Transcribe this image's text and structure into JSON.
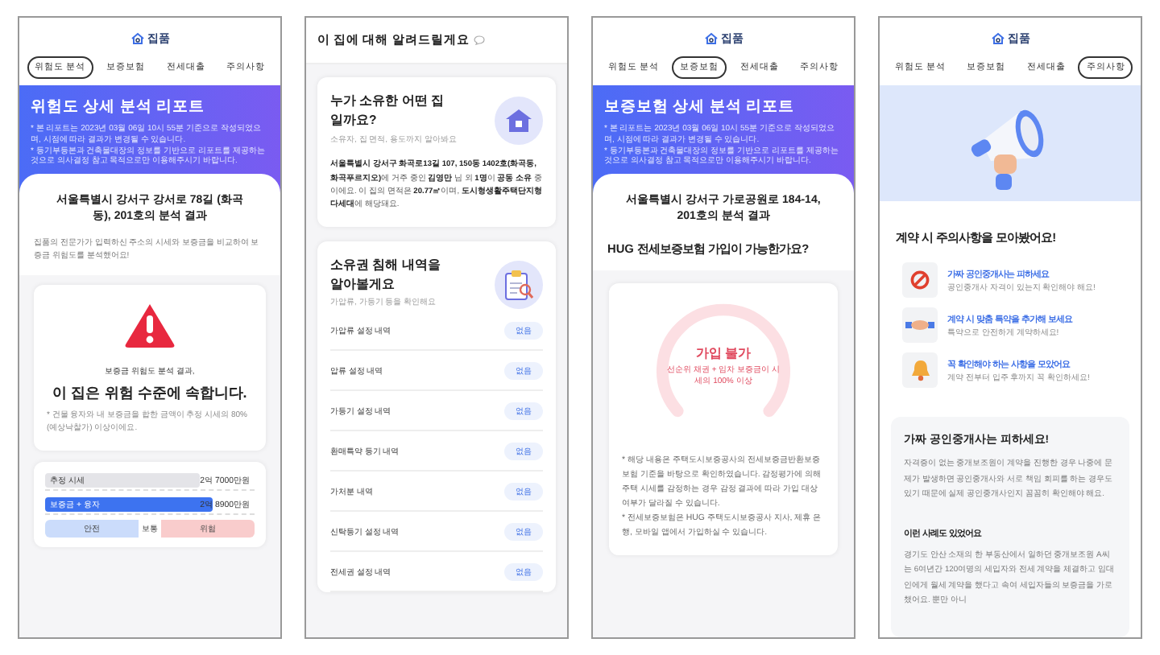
{
  "screens": [
    {
      "kind": "risk",
      "logo": "집품",
      "tabs": [
        {
          "label": "위험도 분석",
          "selected": true
        },
        {
          "label": "보증보험",
          "selected": false
        },
        {
          "label": "전세대출",
          "selected": false
        },
        {
          "label": "주의사항",
          "selected": false
        }
      ],
      "banner": {
        "title": "위험도 상세 분석 리포트",
        "notes": [
          "* 본 리포트는 2023년 03월 06일 10시 55분 기준으로 작성되었으며, 시점에 따라 결과가 변경될 수 있습니다.",
          "* 등기부등본과 건축물대장의 정보를 기반으로 리포트를 제공하는 것으로 의사결정 참고 목적으로만 이용해주시기 바랍니다."
        ]
      },
      "address": "서울특별시 강서구 강서로 78길 (화곡동), 201호의 분석 결과",
      "description": "집품의 전문가가 입력하신 주소의 시세와 보증금을 비교하여 보증금 위험도를 분석했어요!",
      "result": {
        "caption": "보증금 위험도 분석 결과,",
        "headline": "이 집은 **위험** 수준에 속합니다.",
        "note": "* 건물 융자와 내 보증금을 합한 금액이 추정 시세의 80%(예상낙찰가) 이상이에요."
      },
      "bars": [
        {
          "label": "추정 시세",
          "value": "2억 7000만원",
          "level": 0.74,
          "color": "#e4e4e8"
        },
        {
          "label": "보증금 + 융자",
          "value": "2억 8900만원",
          "level": 0.8,
          "color": "#3d73f0"
        }
      ],
      "scale": [
        {
          "label": "안전",
          "color": "#cbdcfb"
        },
        {
          "label": "보통",
          "color": "#ffffff"
        },
        {
          "label": "위험",
          "color": "#f9cccc"
        }
      ]
    },
    {
      "kind": "info",
      "title": "이 집에 대해 알려드릴게요",
      "cards": [
        {
          "kind": "owner",
          "title": "누가 소유한 어떤 집일까요?",
          "subtitle": "소유자, 집 면적, 용도까지 알아봐요",
          "body": "**서울특별시 강서구 화곡로13길 107, 150동 1402호(화곡동, 화곡푸르지오)**에 거주 중인 **김영만** 님 외 **1명**이 **공동 소유** 중이에요. 이 집의 면적은 **20.77㎡**이며, **도시형생활주택단지형다세대**에 해당돼요."
        },
        {
          "kind": "records",
          "title": "소유권 침해 내역을 알아볼게요",
          "subtitle": "가압류, 가등기 등을 확인해요",
          "rows": [
            {
              "label": "가압류 설정 내역",
              "status": "없음"
            },
            {
              "label": "압류 설정 내역",
              "status": "없음"
            },
            {
              "label": "가등기 설정 내역",
              "status": "없음"
            },
            {
              "label": "환매특약 등기 내역",
              "status": "없음"
            },
            {
              "label": "가처분 내역",
              "status": "없음"
            },
            {
              "label": "신탁등기 설정 내역",
              "status": "없음"
            },
            {
              "label": "전세권 설정 내역",
              "status": "없음"
            }
          ]
        }
      ]
    },
    {
      "kind": "insurance",
      "logo": "집품",
      "tabs": [
        {
          "label": "위험도 분석",
          "selected": false
        },
        {
          "label": "보증보험",
          "selected": true
        },
        {
          "label": "전세대출",
          "selected": false
        },
        {
          "label": "주의사항",
          "selected": false
        }
      ],
      "banner": {
        "title": "보증보험 상세 분석 리포트",
        "notes": [
          "* 본 리포트는 2023년 03월 06일 10시 55분 기준으로 작성되었으며, 시점에 따라 결과가 변경될 수 있습니다.",
          "* 등기부등본과 건축물대장의 정보를 기반으로 리포트를 제공하는 것으로 의사결정 참고 목적으로만 이용해주시기 바랍니다."
        ]
      },
      "address": "서울특별시 강서구 가로공원로 184-14, 201호의 분석 결과",
      "question": "HUG 전세보증보험 가입이 가능한가요?",
      "verdict": {
        "title": "가입 불가",
        "detail": "선순위 채권 + 임차 보증금이 시세의 100% 이상"
      },
      "notes": [
        "* 해당 내용은 주택도시보증공사의 전세보증금반환보증보험 기준을 바탕으로 확인하였습니다. 감정평가에 의해 주택 시세를 감정하는 경우 감정 결과에 따라 가입 대상 여부가 달라질 수 있습니다.",
        "* 전세보증보험은 HUG 주택도시보증공사 지사, 제휴 은행, 모바일 앱에서 가입하실 수 있습니다."
      ]
    },
    {
      "kind": "caution",
      "logo": "집품",
      "tabs": [
        {
          "label": "위험도 분석",
          "selected": false
        },
        {
          "label": "보증보험",
          "selected": false
        },
        {
          "label": "전세대출",
          "selected": false
        },
        {
          "label": "주의사항",
          "selected": true
        }
      ],
      "title": "계약 시 주의사항을 모아봤어요!",
      "items": [
        {
          "kind": "prohibit",
          "title": "가짜 공인중개사는 피하세요",
          "subtitle": "공인중개사 자격이 있는지 확인해야 해요!"
        },
        {
          "kind": "handshake",
          "title": "계약 시 맞춤 특약을 추가해 보세요",
          "subtitle": "특약으로 안전하게 계약하세요!"
        },
        {
          "kind": "bell",
          "title": "꼭 확인해야 하는 사항을 모았어요",
          "subtitle": "계약 전부터 입주 후까지 꼭 확인하세요!"
        }
      ],
      "detail": {
        "title": "가짜 공인중개사는 피하세요!",
        "body": "자격증이 없는 중개보조원이 계약을 진행한 경우 나중에 문제가 발생하면 공인중개사와 서로 책임 회피를 하는 경우도 있기 때문에 실제 공인중개사인지 꼼꼼히 확인해야 해요.",
        "case_title": "이런 사례도 있었어요",
        "case_body": "경기도 안산 소재의 한 부동산에서 일하던 중개보조원 A씨는 6여년간 120여명의 세입자와 전세 계약을 체결하고 임대인에게 월세 계약을 했다고 속여 세입자들의 보증금을 가로챘어요. 뿐만 아니"
      }
    }
  ]
}
